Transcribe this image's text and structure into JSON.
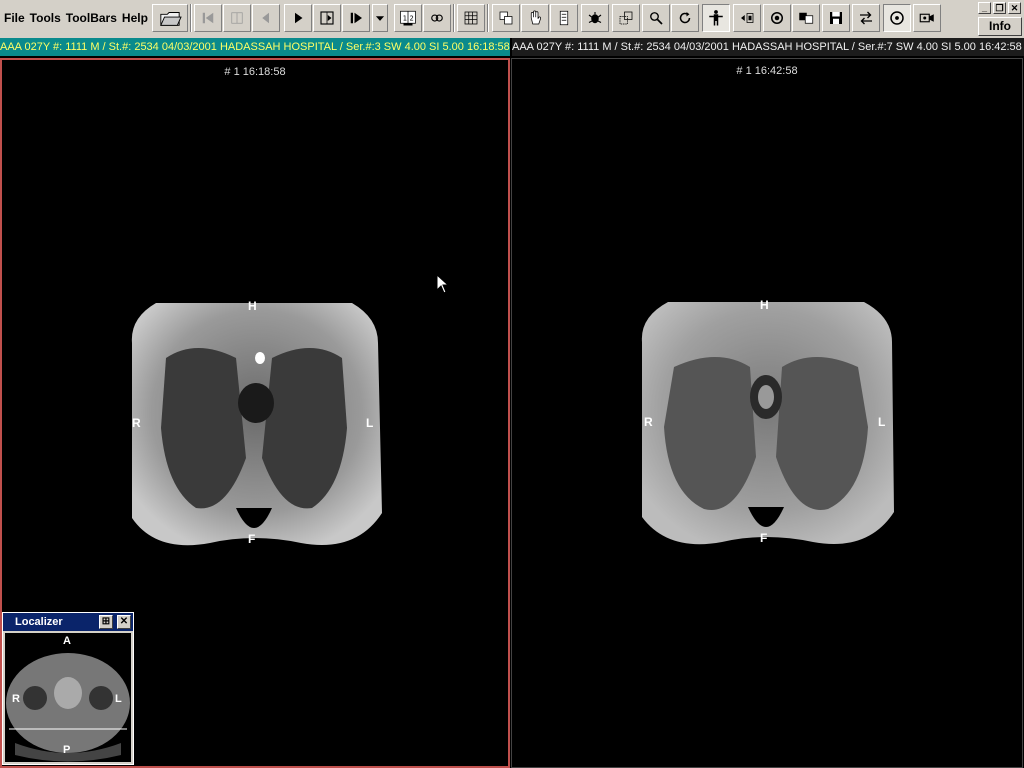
{
  "menu": {
    "file": "File",
    "tools": "Tools",
    "toolbars": "ToolBars",
    "help": "Help"
  },
  "toolbar": {
    "buttons": [
      "open-study",
      "first-frame",
      "prev-series",
      "prev-frame",
      "play",
      "next-series",
      "next-frame",
      "more",
      "layout-1x2",
      "link-series",
      "grid",
      "copy",
      "pan",
      "stack",
      "bug",
      "select-region",
      "zoom",
      "rotate",
      "body-orientation",
      "flip",
      "target",
      "compare",
      "save",
      "swap",
      "cine",
      "video"
    ]
  },
  "window_controls": {
    "minimize": "_",
    "restore": "❐",
    "close": "✕",
    "info": "Info"
  },
  "viewports": {
    "left": {
      "header": "AAA 027Y #: 1111 M / St.#: 2534 04/03/2001 HADASSAH HOSPITAL / Ser.#:3 SW 4.00 SI 5.00 16:18:58",
      "stamp": "# 1 16:18:58",
      "orientation": {
        "top": "H",
        "bottom": "F",
        "left": "R",
        "right": "L"
      }
    },
    "right": {
      "header": "AAA 027Y #: 1111 M / St.#: 2534 04/03/2001 HADASSAH HOSPITAL / Ser.#:7 SW 4.00 SI 5.00 16:42:58",
      "stamp": "# 1 16:42:58",
      "orientation": {
        "top": "H",
        "bottom": "F",
        "left": "R",
        "right": "L"
      }
    }
  },
  "localizer": {
    "title": "Localizer",
    "orientation": {
      "top": "A",
      "bottom": "P",
      "left": "R",
      "right": "L"
    }
  },
  "colors": {
    "toolbar": "#d4d0c8",
    "active_border": "#c0504d",
    "header_active": "#0a8a8c",
    "title_bar": "#0a246a"
  }
}
